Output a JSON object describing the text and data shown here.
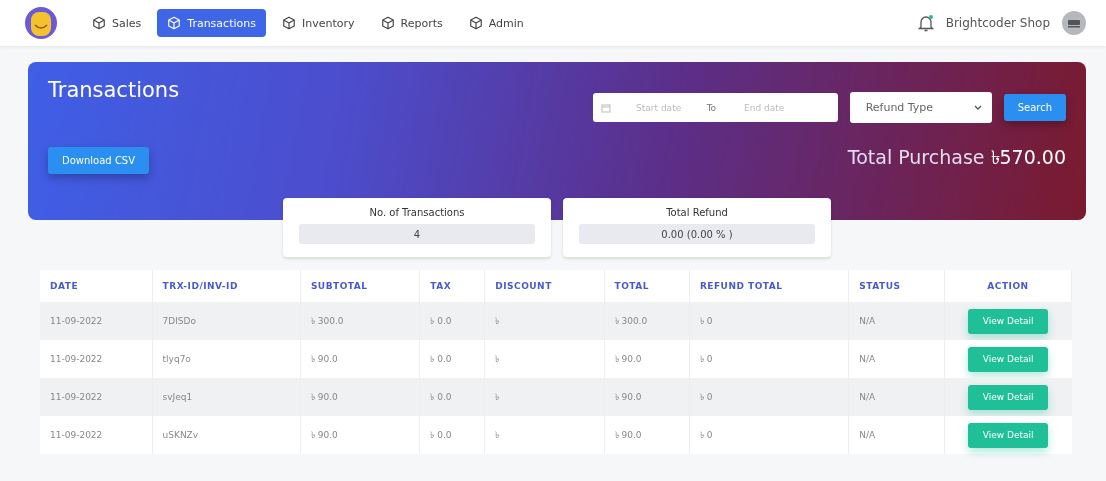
{
  "nav": {
    "items": [
      {
        "label": "Sales",
        "selected": false
      },
      {
        "label": "Transactions",
        "selected": true
      },
      {
        "label": "Inventory",
        "selected": false
      },
      {
        "label": "Reports",
        "selected": false
      },
      {
        "label": "Admin",
        "selected": false
      }
    ],
    "notification": true,
    "shop_name": "Brightcoder Shop"
  },
  "header": {
    "title": "Transactions",
    "start_date": {
      "placeholder": "Start date"
    },
    "to_label": "To",
    "end_date": {
      "placeholder": "End date"
    },
    "refund_type": "Refund Type",
    "search_button": "Search",
    "download_button": "Download CSV",
    "total_purchase": "Total Purchase **৳570.00**"
  },
  "stats": [
    {
      "label": "No. of Transactions",
      "value": "4"
    },
    {
      "label": "Total Refund",
      "value": "0.00 (0.00 % )"
    }
  ],
  "table": {
    "columns": [
      "DATE",
      "TRX-ID/INV-ID",
      "SUBTOTAL",
      "TAX",
      "DISCOUNT",
      "TOTAL",
      "REFUND TOTAL",
      "STATUS",
      "ACTION"
    ],
    "rows": [
      {
        "cells": [
          "11-09-2022",
          "7DISDo",
          "৳ 300.0",
          "৳ 0.0",
          "৳",
          "৳ 300.0",
          "৳ 0",
          "N/A"
        ],
        "action": "View Detail"
      },
      {
        "cells": [
          "11-09-2022",
          "tlyq7o",
          "৳ 90.0",
          "৳ 0.0",
          "৳",
          "৳ 90.0",
          "৳ 0",
          "N/A"
        ],
        "action": "View Detail"
      },
      {
        "cells": [
          "11-09-2022",
          "svJeq1",
          "৳ 90.0",
          "৳ 0.0",
          "৳",
          "৳ 90.0",
          "৳ 0",
          "N/A"
        ],
        "action": "View Detail"
      },
      {
        "cells": [
          "11-09-2022",
          "uSKNZv",
          "৳ 90.0",
          "৳ 0.0",
          "৳",
          "৳ 90.0",
          "৳ 0",
          "N/A"
        ],
        "action": "View Detail"
      }
    ]
  }
}
